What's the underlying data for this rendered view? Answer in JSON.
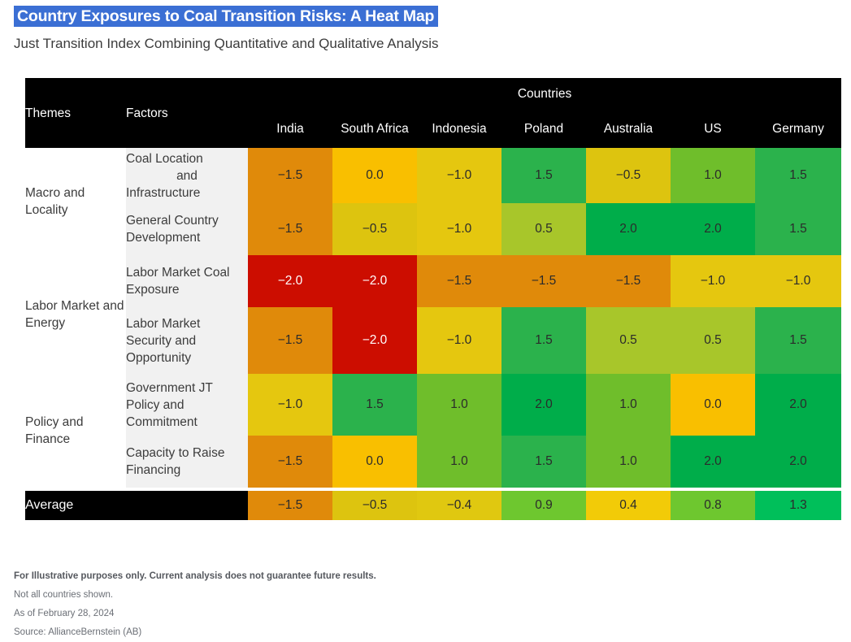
{
  "header": {
    "title": "Country Exposures to Coal Transition Risks: A Heat Map",
    "subtitle": "Just Transition Index Combining Quantitative and Qualitative Analysis",
    "title_highlight_color": "#3b6fd4",
    "title_text_color": "#ffffff"
  },
  "table": {
    "themes_header": "Themes",
    "factors_header": "Factors",
    "countries_header": "Countries",
    "countries": [
      "India",
      "South Africa",
      "Indonesia",
      "Poland",
      "Australia",
      "US",
      "Germany"
    ],
    "average_label": "Average",
    "themes": [
      {
        "name": "Macro and Locality",
        "rows": 2
      },
      {
        "name": "Labor Market and Energy",
        "rows": 2
      },
      {
        "name": "Policy and Finance",
        "rows": 2
      }
    ],
    "rows": [
      {
        "theme": "Macro and Locality",
        "factor": "Coal Location and Infrastructure",
        "factor_lines": [
          "Coal Location",
          "and",
          "Infrastructure"
        ],
        "values": [
          "−1.5",
          "0.0",
          "−1.0",
          "1.5",
          "−0.5",
          "1.0",
          "1.5"
        ],
        "numeric": [
          -1.5,
          0.0,
          -1.0,
          1.5,
          -0.5,
          1.0,
          1.5
        ]
      },
      {
        "theme": "Macro and Locality",
        "factor": "General Country Development",
        "factor_lines": [
          "General Country",
          "Development"
        ],
        "values": [
          "−1.5",
          "−0.5",
          "−1.0",
          "0.5",
          "2.0",
          "2.0",
          "1.5"
        ],
        "numeric": [
          -1.5,
          -0.5,
          -1.0,
          0.5,
          2.0,
          2.0,
          1.5
        ]
      },
      {
        "theme": "Labor Market and Energy",
        "factor": "Labor Market Coal Exposure",
        "factor_lines": [
          "Labor Market",
          "Coal Exposure"
        ],
        "values": [
          "−2.0",
          "−2.0",
          "−1.5",
          "−1.5",
          "−1.5",
          "−1.0",
          "−1.0"
        ],
        "numeric": [
          -2.0,
          -2.0,
          -1.5,
          -1.5,
          -1.5,
          -1.0,
          -1.0
        ]
      },
      {
        "theme": "Labor Market and Energy",
        "factor": "Labor Market Security and Opportunity",
        "factor_lines": [
          "Labor Market",
          "Security and",
          "Opportunity"
        ],
        "values": [
          "−1.5",
          "−2.0",
          "−1.0",
          "1.5",
          "0.5",
          "0.5",
          "1.5"
        ],
        "numeric": [
          -1.5,
          -2.0,
          -1.0,
          1.5,
          0.5,
          0.5,
          1.5
        ]
      },
      {
        "theme": "Policy and Finance",
        "factor": "Government JT Policy and Commitment",
        "factor_lines": [
          "Government",
          "JT Policy and",
          "Commitment"
        ],
        "values": [
          "−1.0",
          "1.5",
          "1.0",
          "2.0",
          "1.0",
          "0.0",
          "2.0"
        ],
        "numeric": [
          -1.0,
          1.5,
          1.0,
          2.0,
          1.0,
          0.0,
          2.0
        ]
      },
      {
        "theme": "Policy and Finance",
        "factor": "Capacity to Raise Financing",
        "factor_lines": [
          "Capacity to",
          "Raise Financing"
        ],
        "values": [
          "−1.5",
          "0.0",
          "1.0",
          "1.5",
          "1.0",
          "2.0",
          "2.0"
        ],
        "numeric": [
          -1.5,
          0.0,
          1.0,
          1.5,
          1.0,
          2.0,
          2.0
        ]
      }
    ],
    "average_row": {
      "values": [
        "−1.5",
        "−0.5",
        "−0.4",
        "0.9",
        "0.4",
        "0.8",
        "1.3"
      ],
      "numeric": [
        -1.5,
        -0.5,
        -0.4,
        0.9,
        0.4,
        0.8,
        1.3
      ]
    }
  },
  "color_scale": {
    "-2.0": "#cc0d00",
    "-1.5": "#e08a0a",
    "-1.0": "#e5c70f",
    "-0.5": "#ddc40f",
    "-0.4": "#e0c810",
    "0.0": "#f9bf00",
    "0.4": "#f2cb08",
    "0.5": "#a8c62a",
    "0.8": "#6ec72f",
    "0.9": "#6ec72f",
    "1.0": "#6fbe2b",
    "1.3": "#00bf5a",
    "1.5": "#2bb24c",
    "2.0": "#00ad4a"
  },
  "footnotes": [
    {
      "text": "For Illustrative purposes only. Current analysis does not guarantee future results.",
      "bold": true
    },
    {
      "text": "Not all countries shown.",
      "bold": false
    },
    {
      "text": "As of February 28, 2024",
      "bold": false
    },
    {
      "text": "Source: AllianceBernstein (AB)",
      "bold": false
    }
  ]
}
